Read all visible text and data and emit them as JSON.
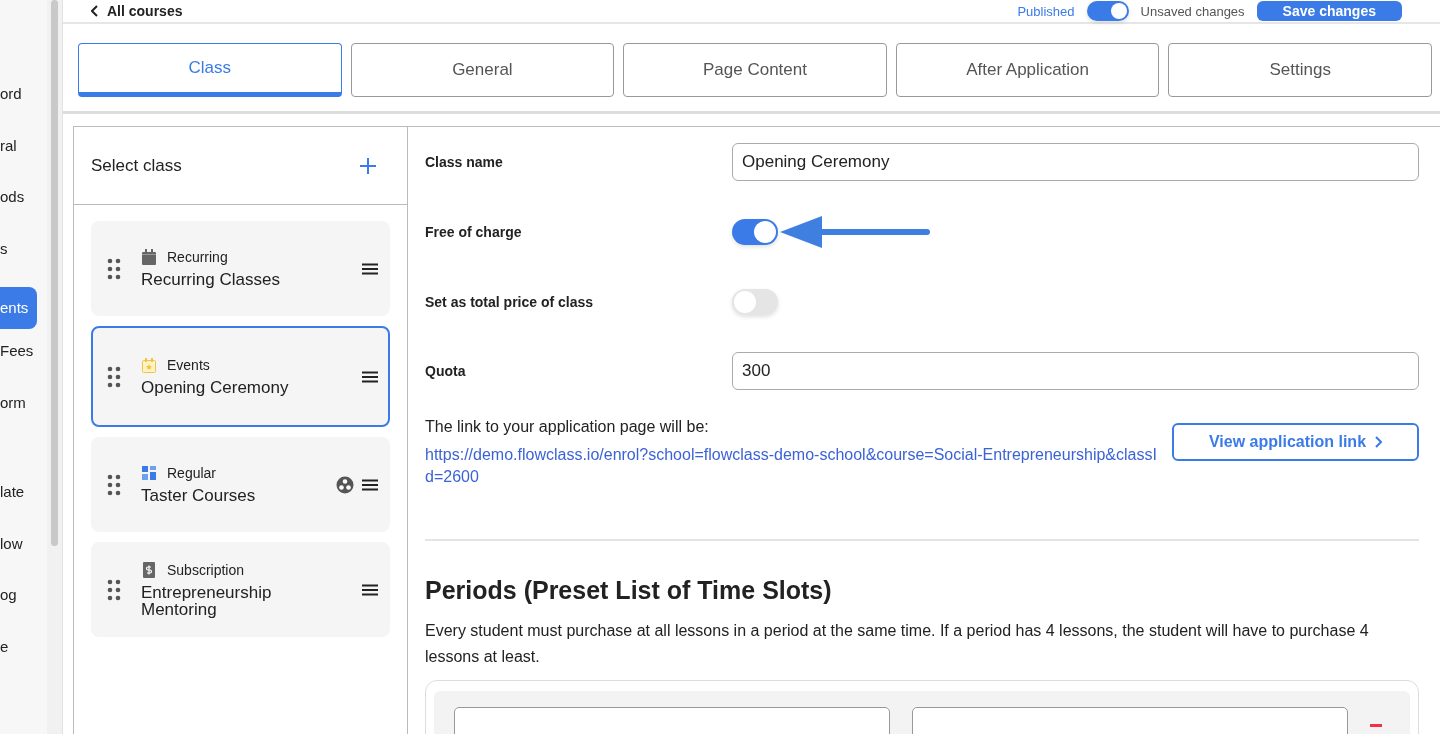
{
  "sidebar": {
    "items": [
      {
        "label": "ord",
        "selected": false
      },
      {
        "label": "ral",
        "selected": false
      },
      {
        "label": "ods",
        "selected": false
      },
      {
        "label": "s",
        "selected": false
      },
      {
        "label": "ents",
        "selected": true
      },
      {
        "label": "Fees",
        "selected": false
      },
      {
        "label": "orm",
        "selected": false
      },
      {
        "label": "late",
        "selected": false
      },
      {
        "label": "low",
        "selected": false
      },
      {
        "label": "og",
        "selected": false
      },
      {
        "label": "e",
        "selected": false
      }
    ]
  },
  "top_bar": {
    "back_link": "All courses",
    "published_label": "Published",
    "published_on": true,
    "unsaved": "Unsaved changes",
    "save_button": "Save changes"
  },
  "tabs": [
    {
      "label": "Class",
      "selected": true
    },
    {
      "label": "General",
      "selected": false
    },
    {
      "label": "Page Content",
      "selected": false
    },
    {
      "label": "After Application",
      "selected": false
    },
    {
      "label": "Settings",
      "selected": false
    }
  ],
  "class_list": {
    "title": "Select class",
    "items": [
      {
        "kind": "recurring",
        "type_label": "Recurring",
        "name": "Recurring Classes",
        "selected": false,
        "group_icon": false
      },
      {
        "kind": "events",
        "type_label": "Events",
        "name": "Opening Ceremony",
        "selected": true,
        "group_icon": false
      },
      {
        "kind": "regular",
        "type_label": "Regular",
        "name": "Taster Courses",
        "selected": false,
        "group_icon": true
      },
      {
        "kind": "subscription",
        "type_label": "Subscription",
        "name": "Entrepreneurship Mentoring",
        "selected": false,
        "group_icon": false
      }
    ]
  },
  "form": {
    "fields": [
      {
        "kind": "text",
        "label": "Class name",
        "value": "Opening Ceremony"
      },
      {
        "kind": "toggle",
        "label": "Free of charge",
        "on": true,
        "pointer": true
      },
      {
        "kind": "toggle",
        "label": "Set as total price of class",
        "on": false,
        "pointer": false
      },
      {
        "kind": "text",
        "label": "Quota",
        "value": "300"
      }
    ],
    "link_intro": "The link to your application page will be:",
    "link_url": "https://demo.flowclass.io/enrol?school=flowclass-demo-school&course=Social-Entrepreneurship&classId=2600",
    "link_button": "View application link"
  },
  "periods": {
    "heading": "Periods (Preset List of Time Slots)",
    "description": "Every student must purchase at all lessons in a period at the same time. If a period has 4 lessons, the student will have to purchase 4 lessons at least."
  }
}
